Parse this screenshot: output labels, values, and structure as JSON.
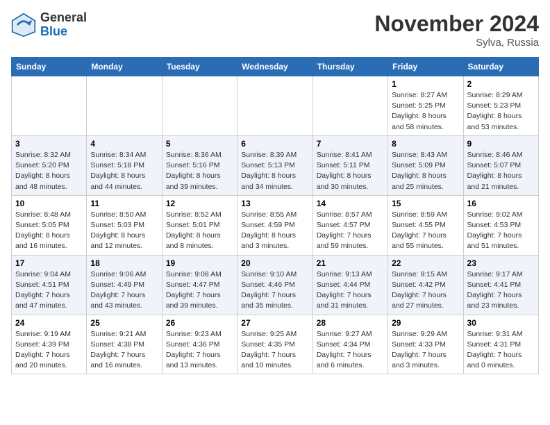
{
  "header": {
    "logo_line1": "General",
    "logo_line2": "Blue",
    "month": "November 2024",
    "location": "Sylva, Russia"
  },
  "weekdays": [
    "Sunday",
    "Monday",
    "Tuesday",
    "Wednesday",
    "Thursday",
    "Friday",
    "Saturday"
  ],
  "weeks": [
    [
      {
        "day": "",
        "info": ""
      },
      {
        "day": "",
        "info": ""
      },
      {
        "day": "",
        "info": ""
      },
      {
        "day": "",
        "info": ""
      },
      {
        "day": "",
        "info": ""
      },
      {
        "day": "1",
        "info": "Sunrise: 8:27 AM\nSunset: 5:25 PM\nDaylight: 8 hours\nand 58 minutes."
      },
      {
        "day": "2",
        "info": "Sunrise: 8:29 AM\nSunset: 5:23 PM\nDaylight: 8 hours\nand 53 minutes."
      }
    ],
    [
      {
        "day": "3",
        "info": "Sunrise: 8:32 AM\nSunset: 5:20 PM\nDaylight: 8 hours\nand 48 minutes."
      },
      {
        "day": "4",
        "info": "Sunrise: 8:34 AM\nSunset: 5:18 PM\nDaylight: 8 hours\nand 44 minutes."
      },
      {
        "day": "5",
        "info": "Sunrise: 8:36 AM\nSunset: 5:16 PM\nDaylight: 8 hours\nand 39 minutes."
      },
      {
        "day": "6",
        "info": "Sunrise: 8:39 AM\nSunset: 5:13 PM\nDaylight: 8 hours\nand 34 minutes."
      },
      {
        "day": "7",
        "info": "Sunrise: 8:41 AM\nSunset: 5:11 PM\nDaylight: 8 hours\nand 30 minutes."
      },
      {
        "day": "8",
        "info": "Sunrise: 8:43 AM\nSunset: 5:09 PM\nDaylight: 8 hours\nand 25 minutes."
      },
      {
        "day": "9",
        "info": "Sunrise: 8:46 AM\nSunset: 5:07 PM\nDaylight: 8 hours\nand 21 minutes."
      }
    ],
    [
      {
        "day": "10",
        "info": "Sunrise: 8:48 AM\nSunset: 5:05 PM\nDaylight: 8 hours\nand 16 minutes."
      },
      {
        "day": "11",
        "info": "Sunrise: 8:50 AM\nSunset: 5:03 PM\nDaylight: 8 hours\nand 12 minutes."
      },
      {
        "day": "12",
        "info": "Sunrise: 8:52 AM\nSunset: 5:01 PM\nDaylight: 8 hours\nand 8 minutes."
      },
      {
        "day": "13",
        "info": "Sunrise: 8:55 AM\nSunset: 4:59 PM\nDaylight: 8 hours\nand 3 minutes."
      },
      {
        "day": "14",
        "info": "Sunrise: 8:57 AM\nSunset: 4:57 PM\nDaylight: 7 hours\nand 59 minutes."
      },
      {
        "day": "15",
        "info": "Sunrise: 8:59 AM\nSunset: 4:55 PM\nDaylight: 7 hours\nand 55 minutes."
      },
      {
        "day": "16",
        "info": "Sunrise: 9:02 AM\nSunset: 4:53 PM\nDaylight: 7 hours\nand 51 minutes."
      }
    ],
    [
      {
        "day": "17",
        "info": "Sunrise: 9:04 AM\nSunset: 4:51 PM\nDaylight: 7 hours\nand 47 minutes."
      },
      {
        "day": "18",
        "info": "Sunrise: 9:06 AM\nSunset: 4:49 PM\nDaylight: 7 hours\nand 43 minutes."
      },
      {
        "day": "19",
        "info": "Sunrise: 9:08 AM\nSunset: 4:47 PM\nDaylight: 7 hours\nand 39 minutes."
      },
      {
        "day": "20",
        "info": "Sunrise: 9:10 AM\nSunset: 4:46 PM\nDaylight: 7 hours\nand 35 minutes."
      },
      {
        "day": "21",
        "info": "Sunrise: 9:13 AM\nSunset: 4:44 PM\nDaylight: 7 hours\nand 31 minutes."
      },
      {
        "day": "22",
        "info": "Sunrise: 9:15 AM\nSunset: 4:42 PM\nDaylight: 7 hours\nand 27 minutes."
      },
      {
        "day": "23",
        "info": "Sunrise: 9:17 AM\nSunset: 4:41 PM\nDaylight: 7 hours\nand 23 minutes."
      }
    ],
    [
      {
        "day": "24",
        "info": "Sunrise: 9:19 AM\nSunset: 4:39 PM\nDaylight: 7 hours\nand 20 minutes."
      },
      {
        "day": "25",
        "info": "Sunrise: 9:21 AM\nSunset: 4:38 PM\nDaylight: 7 hours\nand 16 minutes."
      },
      {
        "day": "26",
        "info": "Sunrise: 9:23 AM\nSunset: 4:36 PM\nDaylight: 7 hours\nand 13 minutes."
      },
      {
        "day": "27",
        "info": "Sunrise: 9:25 AM\nSunset: 4:35 PM\nDaylight: 7 hours\nand 10 minutes."
      },
      {
        "day": "28",
        "info": "Sunrise: 9:27 AM\nSunset: 4:34 PM\nDaylight: 7 hours\nand 6 minutes."
      },
      {
        "day": "29",
        "info": "Sunrise: 9:29 AM\nSunset: 4:33 PM\nDaylight: 7 hours\nand 3 minutes."
      },
      {
        "day": "30",
        "info": "Sunrise: 9:31 AM\nSunset: 4:31 PM\nDaylight: 7 hours\nand 0 minutes."
      }
    ]
  ]
}
